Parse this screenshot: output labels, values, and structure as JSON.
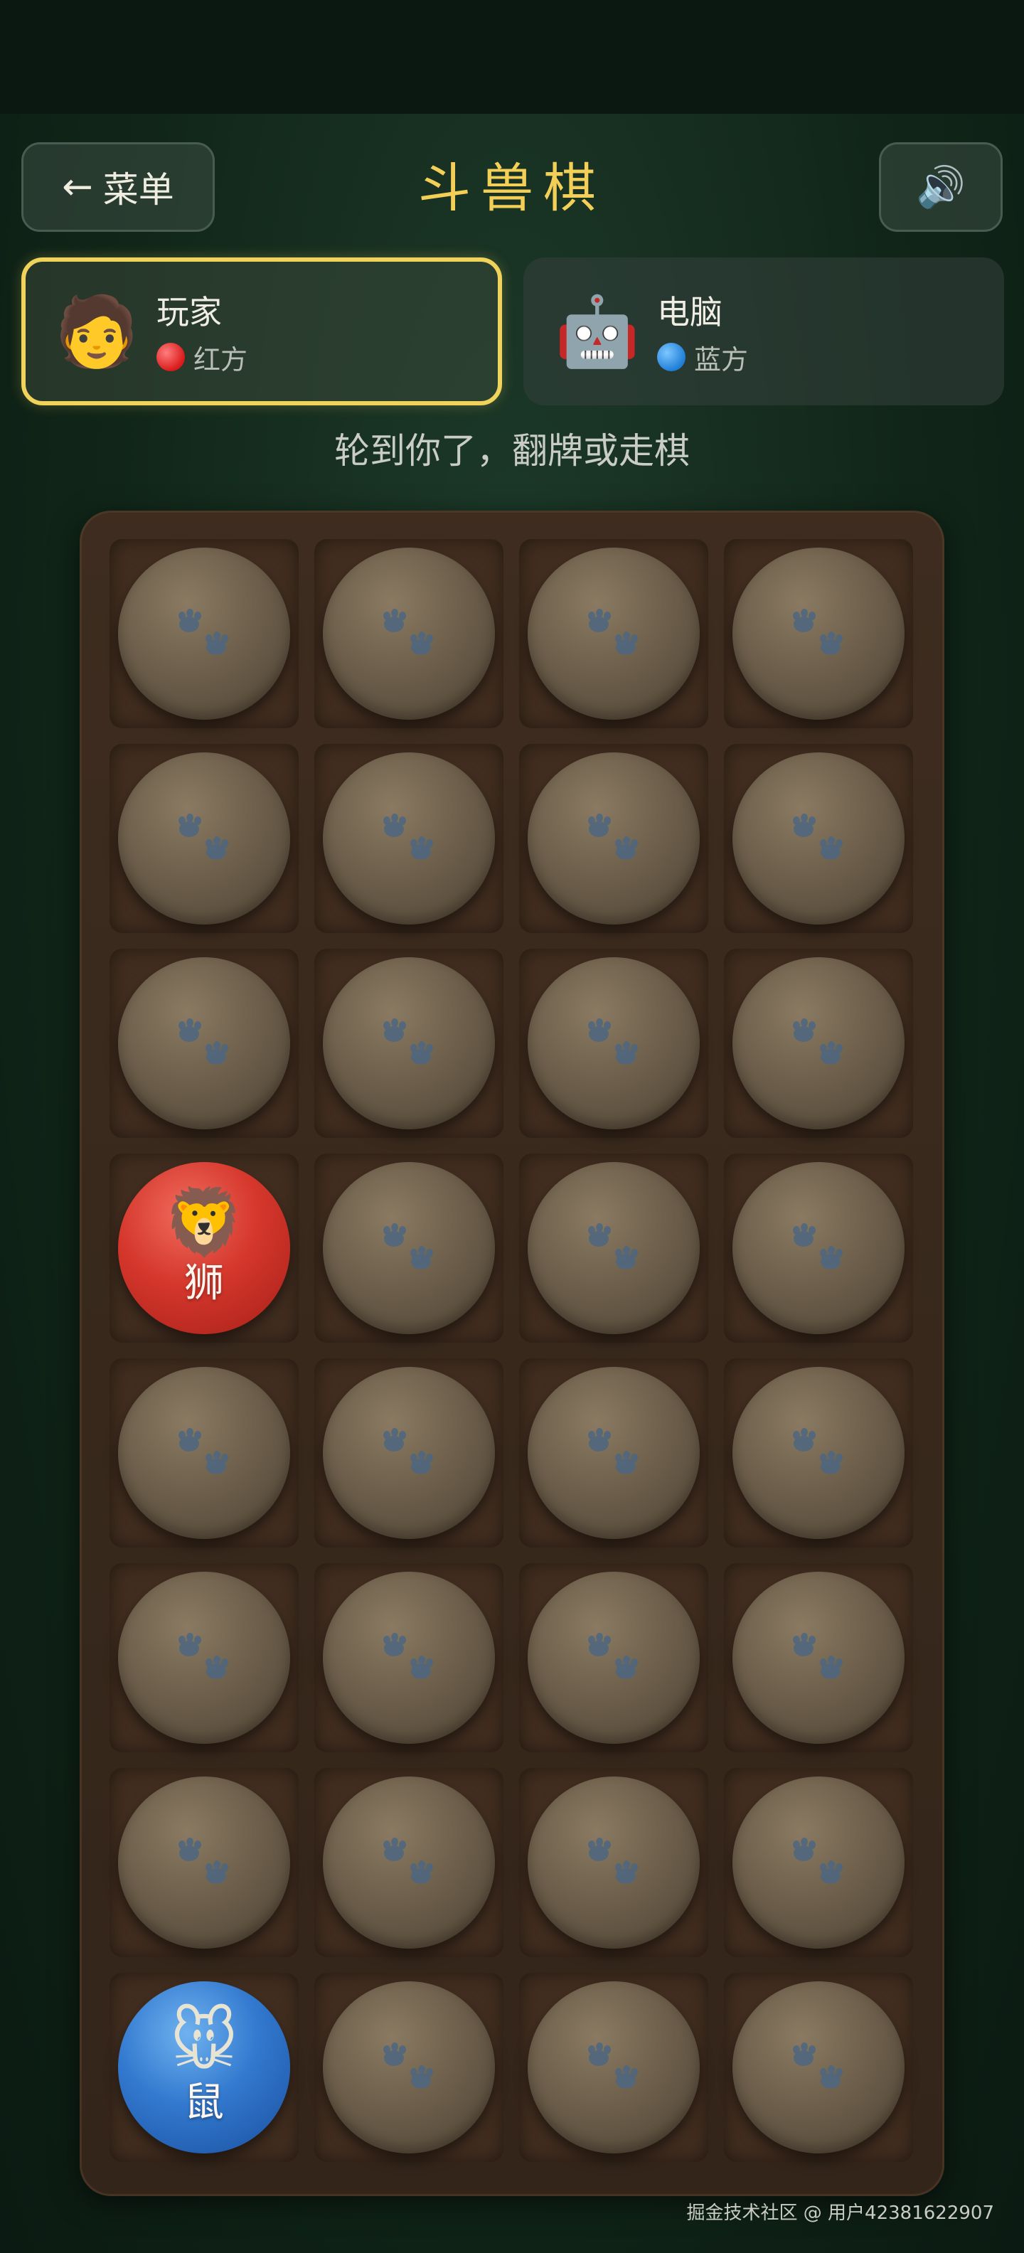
{
  "header": {
    "back_arrow": "←",
    "menu_label": "菜单",
    "title": "斗兽棋",
    "sound_icon": "🔊"
  },
  "players": [
    {
      "avatar": "🧑",
      "name": "玩家",
      "side": "红方",
      "side_color": "#d91b1b",
      "active": true
    },
    {
      "avatar": "🤖",
      "name": "电脑",
      "side": "蓝方",
      "side_color": "#1f7fd8",
      "active": false
    }
  ],
  "turn_message": "轮到你了，翻牌或走棋",
  "board": {
    "rows": 8,
    "cols": 4,
    "colors": {
      "hidden": "#6d5f4b",
      "paw": "#4e6781",
      "red": "#d5372c",
      "blue": "#3279cf"
    },
    "revealed": [
      {
        "row": 3,
        "col": 0,
        "side": "red",
        "emoji": "🦁",
        "name": "狮"
      },
      {
        "row": 7,
        "col": 0,
        "side": "blue",
        "emoji": "🐭",
        "name": "鼠"
      }
    ]
  },
  "watermark": "掘金技术社区 @ 用户42381622907"
}
